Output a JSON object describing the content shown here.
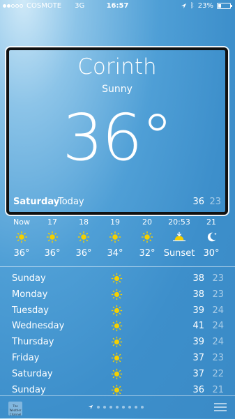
{
  "status": {
    "carrier": "COSMOTE",
    "network": "3G",
    "time": "16:57",
    "battery": "23%",
    "signal_dots": [
      1,
      1,
      0,
      0,
      0
    ]
  },
  "hero": {
    "city": "Corinth",
    "condition": "Sunny",
    "temperature": "36°",
    "day": "Saturday",
    "today_label": "Today",
    "high": "36",
    "low": "23"
  },
  "hourly": [
    {
      "label": "Now",
      "icon": "sun-icon",
      "temp": "36°"
    },
    {
      "label": "17",
      "icon": "sun-icon",
      "temp": "36°"
    },
    {
      "label": "18",
      "icon": "sun-icon",
      "temp": "36°"
    },
    {
      "label": "19",
      "icon": "sun-icon",
      "temp": "34°"
    },
    {
      "label": "20",
      "icon": "sun-icon",
      "temp": "32°"
    },
    {
      "label": "20:53",
      "icon": "sunset-icon",
      "temp": "Sunset"
    },
    {
      "label": "21",
      "icon": "moon-icon",
      "temp": "30°"
    }
  ],
  "daily": [
    {
      "day": "Sunday",
      "icon": "sun-icon",
      "high": "38",
      "low": "23"
    },
    {
      "day": "Monday",
      "icon": "sun-icon",
      "high": "38",
      "low": "23"
    },
    {
      "day": "Tuesday",
      "icon": "sun-icon",
      "high": "39",
      "low": "24"
    },
    {
      "day": "Wednesday",
      "icon": "sun-icon",
      "high": "41",
      "low": "24"
    },
    {
      "day": "Thursday",
      "icon": "sun-icon",
      "high": "39",
      "low": "24"
    },
    {
      "day": "Friday",
      "icon": "sun-icon",
      "high": "37",
      "low": "23"
    },
    {
      "day": "Saturday",
      "icon": "sun-icon",
      "high": "37",
      "low": "22"
    },
    {
      "day": "Sunday",
      "icon": "sun-icon",
      "high": "36",
      "low": "21"
    }
  ],
  "bottom": {
    "logo_text": "The Weather Channel",
    "page_count": 8
  },
  "colors": {
    "sun": "#f5d000",
    "background": "#3d8fcb"
  }
}
